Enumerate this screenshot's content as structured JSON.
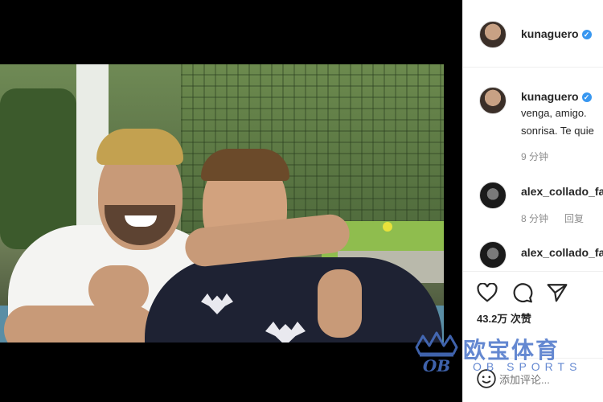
{
  "post": {
    "author": "kunaguero",
    "caption_username": "kunaguero",
    "caption_lines": [
      "venga, amigo.",
      "sonrisa. Te quie"
    ],
    "caption_time": "9 分钟"
  },
  "comments": [
    {
      "username": "alex_collado_fa",
      "time": "8 分钟",
      "reply_label": "回复"
    },
    {
      "username": "alex_collado_fa"
    }
  ],
  "actions": {
    "like_icon": "heart-icon",
    "comment_icon": "comment-icon",
    "share_icon": "send-icon"
  },
  "likes_text": "43.2万 次赞",
  "comment_box": {
    "placeholder": "添加评论...",
    "emoji_icon": "smiley-icon"
  },
  "watermark": {
    "brand_cn": "欧宝体育",
    "brand_en": "OB SPORTS",
    "logo_letters": "OB"
  },
  "colors": {
    "verified": "#3897f0",
    "watermark": "#4a74c9",
    "meta": "#8e8e8e"
  }
}
